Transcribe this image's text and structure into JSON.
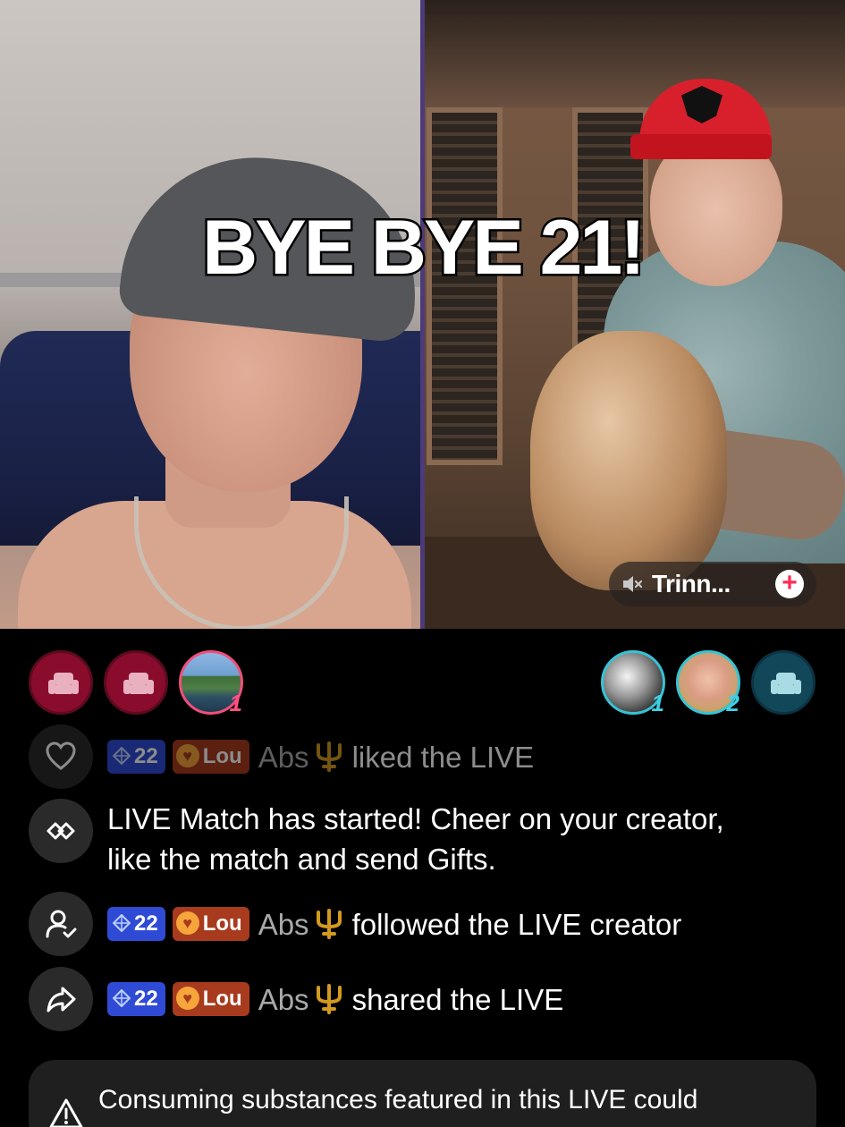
{
  "overlay": {
    "headline": "BYE BYE 21!"
  },
  "guest": {
    "name": "Trinn...",
    "add_symbol": "+"
  },
  "viewer_seats": {
    "left": [
      {
        "kind": "empty-seat",
        "icon": "sofa-icon"
      },
      {
        "kind": "empty-seat",
        "icon": "sofa-icon"
      },
      {
        "kind": "avatar",
        "rank": "1"
      }
    ],
    "right": [
      {
        "kind": "avatar",
        "rank": "1"
      },
      {
        "kind": "avatar",
        "rank": "2"
      },
      {
        "kind": "empty-seat",
        "icon": "sofa-icon"
      }
    ]
  },
  "chat": [
    {
      "icon": "heart-icon",
      "level": "22",
      "fan_badge": "Lou",
      "username": "Abs",
      "text": "liked the LIVE"
    },
    {
      "icon": "match-icon",
      "text": "LIVE Match has started! Cheer on your creator, like the match and send Gifts."
    },
    {
      "icon": "follow-icon",
      "level": "22",
      "fan_badge": "Lou",
      "username": "Abs",
      "text": "followed the LIVE creator"
    },
    {
      "icon": "share-icon",
      "level": "22",
      "fan_badge": "Lou",
      "username": "Abs",
      "text": "shared the LIVE"
    }
  ],
  "warning": {
    "icon": "warning-icon",
    "text": "Consuming substances featured in this LIVE could"
  },
  "colors": {
    "accent_pink": "#fe2c55",
    "level_badge": "#2f4bd6",
    "fan_badge": "#a83b1e",
    "divider": "#4d3a7a"
  }
}
